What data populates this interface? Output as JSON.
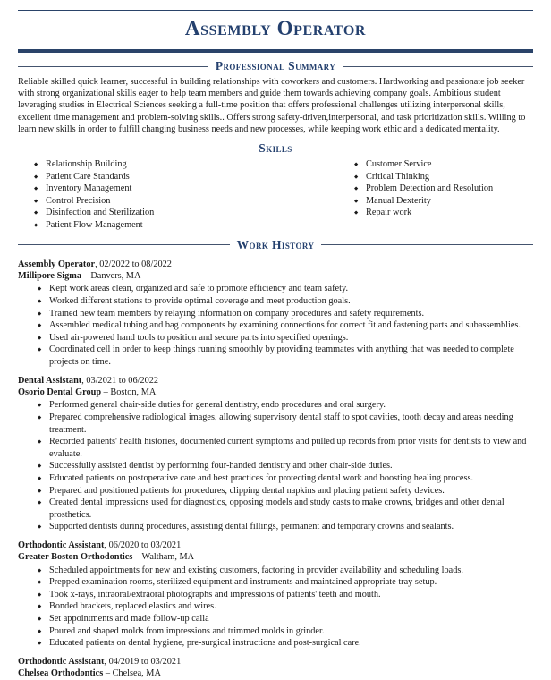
{
  "document": {
    "title": "Assembly Operator",
    "accent_color": "#24406e",
    "rule_color": "#2a4369",
    "text_color": "#1a1a1a"
  },
  "sections": {
    "summary": {
      "heading": "Professional Summary",
      "text": "Reliable skilled quick learner, successful in building relationships with coworkers and customers. Hardworking and passionate job seeker with strong organizational skills eager to help team members and guide them towards achieving company goals. Ambitious student leveraging studies in Electrical Sciences seeking a full-time position that offers professional challenges utilizing interpersonal skills, excellent time management and problem-solving skills.. Offers strong safety-driven,interpersonal, and task prioritization skills. Willing to learn new skills in order to fulfill changing business needs and new processes, while keeping work ethic and a dedicated mentality."
    },
    "skills": {
      "heading": "Skills",
      "left_column": [
        "Relationship Building",
        "Patient Care Standards",
        "Inventory Management",
        "Control Precision",
        "Disinfection and Sterilization",
        "Patient Flow Management"
      ],
      "right_column": [
        "Customer Service",
        "Critical Thinking",
        "Problem Detection and Resolution",
        "Manual Dexterity",
        "Repair work"
      ]
    },
    "work_history": {
      "heading": "Work History",
      "jobs": [
        {
          "title": "Assembly Operator",
          "dates": "02/2022 to 08/2022",
          "company": "Millipore Sigma",
          "location": "Danvers, MA",
          "separator": "–",
          "bullets": [
            "Kept work areas clean, organized and safe to promote efficiency and team safety.",
            "Worked different stations to provide optimal coverage and meet production goals.",
            "Trained new team members by relaying information on company procedures and safety requirements.",
            "Assembled medical tubing and bag components by examining connections for correct fit and fastening parts and subassemblies.",
            "Used air-powered hand tools to position and secure parts into specified openings.",
            "Coordinated cell in order to keep things running smoothly by providing teammates with anything that was needed to complete projects on time."
          ]
        },
        {
          "title": "Dental Assistant",
          "dates": "03/2021 to 06/2022",
          "company": "Osorio Dental Group",
          "location": "Boston, MA",
          "separator": "–",
          "bullets": [
            "Performed general chair-side duties for general dentistry, endo procedures and oral surgery.",
            "Prepared comprehensive radiological images, allowing supervisory dental staff to spot cavities, tooth decay and areas needing treatment.",
            "Recorded patients' health histories, documented current symptoms and pulled up records from prior visits for dentists to view and evaluate.",
            "Successfully assisted dentist by performing four-handed dentistry and other chair-side duties.",
            "Educated patients on postoperative care and best practices for protecting dental work and boosting healing process.",
            "Prepared and positioned patients for procedures, clipping dental napkins and placing patient safety devices.",
            "Created dental impressions used for diagnostics, opposing models and study casts to make crowns, bridges and other dental prosthetics.",
            "Supported dentists during procedures, assisting dental fillings, permanent and temporary crowns and sealants."
          ]
        },
        {
          "title": "Orthodontic Assistant",
          "dates": "06/2020 to 03/2021",
          "company": "Greater Boston Orthodontics",
          "location": "Waltham, MA",
          "separator": "–",
          "bullets": [
            "Scheduled appointments for new and existing customers, factoring in provider availability and scheduling loads.",
            "Prepped examination rooms, sterilized equipment and instruments and maintained appropriate tray setup.",
            "Took x-rays, intraoral/extraoral photographs and impressions of patients' teeth and mouth.",
            "Bonded brackets, replaced elastics and wires.",
            "Set appointments and made follow-up calla",
            "Poured and shaped molds from impressions and trimmed molds in grinder.",
            "Educated patients on dental hygiene, pre-surgical instructions and post-surgical care."
          ]
        },
        {
          "title": "Orthodontic Assistant",
          "dates": "04/2019 to 03/2021",
          "company": "Chelsea Orthodontics",
          "location": "Chelsea, MA",
          "separator": "–",
          "bullets": []
        }
      ]
    }
  }
}
